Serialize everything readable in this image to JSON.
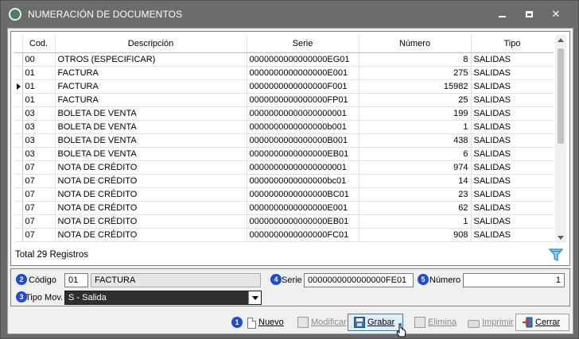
{
  "window": {
    "title": "NUMERACIÓN DE DOCUMENTOS",
    "colors": {
      "titlebar": "#6c6c6c",
      "badge": "#1f4bd6",
      "select_bg": "#2f2f2f"
    }
  },
  "grid": {
    "columns": [
      "Cod.",
      "Descripción",
      "Serie",
      "Número",
      "Tipo"
    ],
    "selected_row": 2,
    "rows": [
      {
        "cod": "00",
        "desc": "OTROS (ESPECIFICAR)",
        "serie": "0000000000000000EG01",
        "numero": "8",
        "tipo": "SALIDAS"
      },
      {
        "cod": "01",
        "desc": "FACTURA",
        "serie": "0000000000000000E001",
        "numero": "275",
        "tipo": "SALIDAS"
      },
      {
        "cod": "01",
        "desc": "FACTURA",
        "serie": "0000000000000000F001",
        "numero": "15982",
        "tipo": "SALIDAS"
      },
      {
        "cod": "01",
        "desc": "FACTURA",
        "serie": "0000000000000000FP01",
        "numero": "25",
        "tipo": "SALIDAS"
      },
      {
        "cod": "03",
        "desc": "BOLETA DE VENTA",
        "serie": "00000000000000000001",
        "numero": "199",
        "tipo": "SALIDAS"
      },
      {
        "cod": "03",
        "desc": "BOLETA DE VENTA",
        "serie": "0000000000000000b001",
        "numero": "1",
        "tipo": "SALIDAS"
      },
      {
        "cod": "03",
        "desc": "BOLETA DE VENTA",
        "serie": "0000000000000000B001",
        "numero": "438",
        "tipo": "SALIDAS"
      },
      {
        "cod": "03",
        "desc": "BOLETA DE VENTA",
        "serie": "0000000000000000EB01",
        "numero": "6",
        "tipo": "SALIDAS"
      },
      {
        "cod": "07",
        "desc": "NOTA DE CRÉDITO",
        "serie": "00000000000000000001",
        "numero": "974",
        "tipo": "SALIDAS"
      },
      {
        "cod": "07",
        "desc": "NOTA DE CRÉDITO",
        "serie": "0000000000000000bc01",
        "numero": "14",
        "tipo": "SALIDAS"
      },
      {
        "cod": "07",
        "desc": "NOTA DE CRÉDITO",
        "serie": "0000000000000000BC01",
        "numero": "23",
        "tipo": "SALIDAS"
      },
      {
        "cod": "07",
        "desc": "NOTA DE CRÉDITO",
        "serie": "0000000000000000E001",
        "numero": "62",
        "tipo": "SALIDAS"
      },
      {
        "cod": "07",
        "desc": "NOTA DE CRÉDITO",
        "serie": "0000000000000000EB01",
        "numero": "1",
        "tipo": "SALIDAS"
      },
      {
        "cod": "07",
        "desc": "NOTA DE CRÉDITO",
        "serie": "0000000000000000FC01",
        "numero": "908",
        "tipo": "SALIDAS"
      }
    ],
    "total_text": "Total 29 Registros"
  },
  "form": {
    "codigo": {
      "badge": "2",
      "label": "Código",
      "value": "01",
      "desc": "FACTURA"
    },
    "serie": {
      "badge": "4",
      "label": "Serie",
      "value": "0000000000000000FE01"
    },
    "numero": {
      "badge": "5",
      "label": "Número",
      "value": "1"
    },
    "tipo_mov": {
      "badge": "3",
      "label": "Tipo Mov.",
      "value": "S - Salida"
    }
  },
  "toolbar": {
    "badge": "1",
    "nuevo": "Nuevo",
    "modificar": "Modificar",
    "grabar": "Grabar",
    "elimina": "Elimina",
    "imprimir": "Imprimir",
    "cerrar": "Cerrar"
  }
}
